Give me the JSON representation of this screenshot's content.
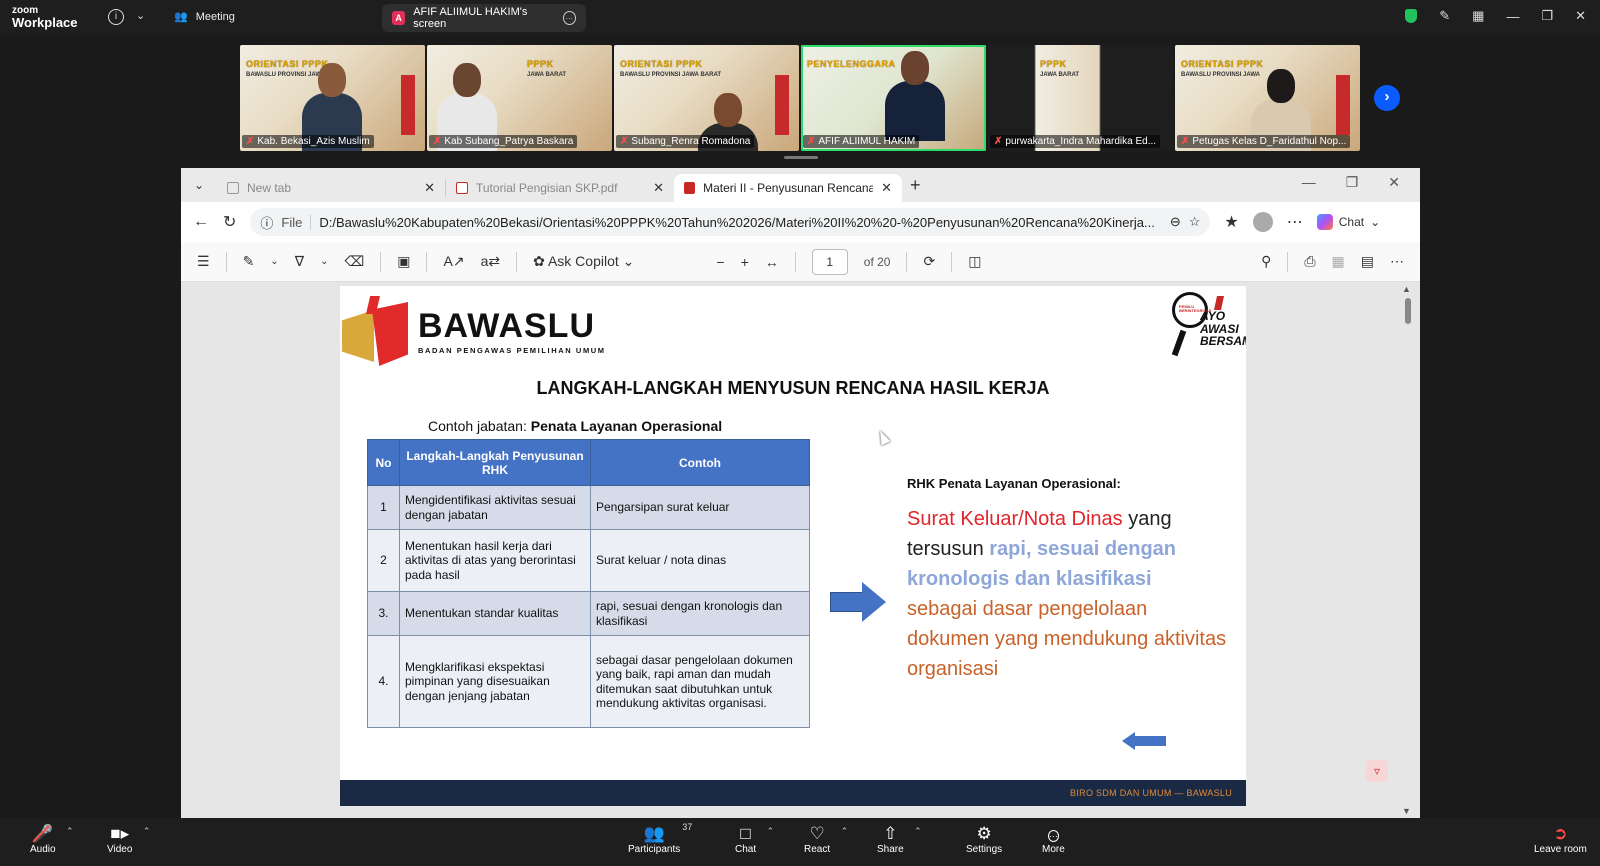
{
  "zoom": {
    "logo_top": "zoom",
    "logo_bottom": "Workplace",
    "meeting_label": "Meeting",
    "screen_share_label": "AFIF ALIIMUL HAKIM's screen",
    "screen_share_avatar": "A",
    "accent_green": "#2edc6a",
    "accent_blue": "#0b5cff"
  },
  "gallery": [
    {
      "name": "Kab. Bekasi_Azis Muslim",
      "banner": "ORIENTASI PPPK",
      "sub": "BAWASLU PROVINSI JAWA",
      "active": false
    },
    {
      "name": "Kab Subang_Patrya Baskara",
      "banner": "PPPK",
      "sub": "JAWA BARAT",
      "active": false
    },
    {
      "name": "Subang_Renra Romadona",
      "banner": "ORIENTASI PPPK",
      "sub": "BAWASLU PROVINSI JAWA BARAT",
      "active": false
    },
    {
      "name": "AFIF ALIIMUL HAKIM",
      "banner": "PENYELENGGARA",
      "sub": "",
      "active": true
    },
    {
      "name": "purwakarta_Indra Mahardika Ed...",
      "banner": "PPPK",
      "sub": "JAWA BARAT",
      "active": false
    },
    {
      "name": "Petugas Kelas D_Faridathul Nop...",
      "banner": "ORIENTASI PPPK",
      "sub": "BAWASLU PROVINSI JAWA",
      "active": false
    }
  ],
  "browser": {
    "tabs": [
      {
        "label": "New tab",
        "icon": "page-icon",
        "active": false
      },
      {
        "label": "Tutorial Pengisian SKP.pdf",
        "icon": "pdf-icon",
        "active": false
      },
      {
        "label": "Materi II - Penyusunan Rencana Ki",
        "icon": "pdf-icon",
        "active": true
      }
    ],
    "file_label": "File",
    "url": "D:/Bawaslu%20Kabupaten%20Bekasi/Orientasi%20PPPK%20Tahun%202026/Materi%20II%20%20-%20Penyusunan%20Rencana%20Kinerja...",
    "chat_label": "Chat"
  },
  "pdf_toolbar": {
    "ask_copilot": "Ask Copilot",
    "page_current": "1",
    "page_total": "of 20"
  },
  "slide": {
    "org_name": "BAWASLU",
    "org_subtitle": "BADAN PENGAWAS PEMILIHAN UMUM",
    "campaign_top": "AYO",
    "campaign_mid": "AWASI",
    "campaign_bottom": "BERSAMA",
    "campaign_circle": "PEMILU BERINTEGRITAS",
    "title": "LANGKAH-LANGKAH MENYUSUN RENCANA HASIL KERJA",
    "jabatan_prefix": "Contoh jabatan:",
    "jabatan_value": "Penata Layanan Operasional",
    "table_headers": [
      "No",
      "Langkah-Langkah Penyusunan RHK",
      "Contoh"
    ],
    "table_rows": [
      {
        "no": "1",
        "step": "Mengidentifikasi aktivitas sesuai dengan jabatan",
        "example": "Pengarsipan surat keluar"
      },
      {
        "no": "2",
        "step": "Menentukan hasil kerja dari aktivitas di atas yang berorintasi pada hasil",
        "example": "Surat keluar / nota dinas"
      },
      {
        "no": "3.",
        "step": "Menentukan standar kualitas",
        "example": "rapi, sesuai dengan kronologis dan klasifikasi"
      },
      {
        "no": "4.",
        "step": "Mengklarifikasi ekspektasi pimpinan yang disesuaikan dengan jenjang jabatan",
        "example": "sebagai dasar pengelolaan dokumen yang baik, rapi aman dan mudah ditemukan saat dibutuhkan untuk mendukung aktivitas organisasi."
      }
    ],
    "rhk_heading": "RHK Penata Layanan Operasional:",
    "rhk_red": "Surat Keluar/Nota Dinas",
    "rhk_black1": " yang tersusun ",
    "rhk_blue": "rapi, sesuai dengan kronologis dan klasifikasi",
    "rhk_orange": "sebagai dasar pengelolaan dokumen yang mendukung aktivitas organisasi",
    "footer": "BIRO SDM DAN UMUM — BAWASLU",
    "colors": {
      "table_header": "#4472c4",
      "red": "#e0252b",
      "blue": "#8ea6d8",
      "orange": "#c8622a"
    }
  },
  "bottom_bar": {
    "audio": "Audio",
    "video": "Video",
    "participants": "Participants",
    "participants_count": "37",
    "chat": "Chat",
    "react": "React",
    "share": "Share",
    "settings": "Settings",
    "more": "More",
    "leave": "Leave room"
  }
}
